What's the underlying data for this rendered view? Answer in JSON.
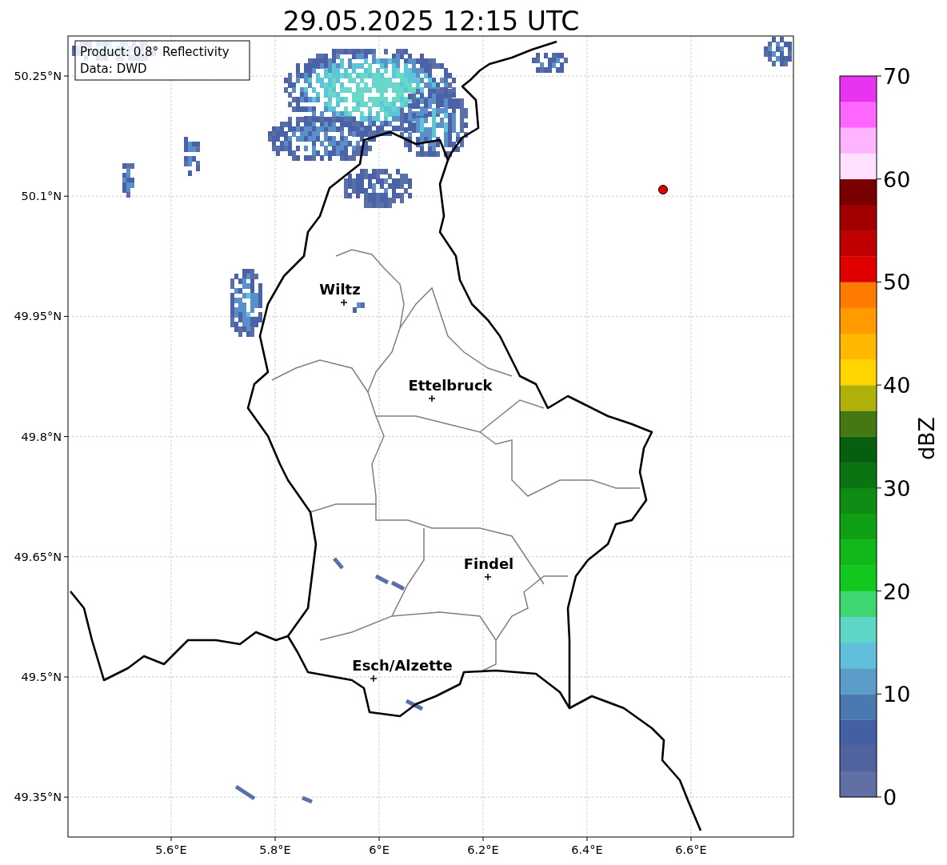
{
  "title": "29.05.2025 12:15 UTC",
  "info_box": [
    "Product: 0.8° Reflectivity",
    "Data: DWD"
  ],
  "lat_ticks": [
    "50.25°N",
    "50.1°N",
    "49.95°N",
    "49.8°N",
    "49.65°N",
    "49.5°N",
    "49.35°N"
  ],
  "lon_ticks": [
    "5.6°E",
    "5.8°E",
    "6°E",
    "6.2°E",
    "6.4°E",
    "6.6°E"
  ],
  "cities": [
    {
      "name": "Wiltz"
    },
    {
      "name": "Ettelbruck"
    },
    {
      "name": "Findel"
    },
    {
      "name": "Esch/Alzette"
    }
  ],
  "colorbar": {
    "label": "dBZ",
    "ticks": [
      "70",
      "60",
      "50",
      "40",
      "30",
      "20",
      "10",
      "0"
    ],
    "segments": [
      {
        "color": "#6070a4"
      },
      {
        "color": "#50639e"
      },
      {
        "color": "#4360a5"
      },
      {
        "color": "#4a78b0"
      },
      {
        "color": "#5a9dc8"
      },
      {
        "color": "#62bfdc"
      },
      {
        "color": "#5ed6c6"
      },
      {
        "color": "#3ed670"
      },
      {
        "color": "#10c81e"
      },
      {
        "color": "#10b81a"
      },
      {
        "color": "#10a016"
      },
      {
        "color": "#0e8c14"
      },
      {
        "color": "#0b7412"
      },
      {
        "color": "#075e0e"
      },
      {
        "color": "#447810"
      },
      {
        "color": "#b0b00a"
      },
      {
        "color": "#ffd500"
      },
      {
        "color": "#ffb800"
      },
      {
        "color": "#ff9a00"
      },
      {
        "color": "#ff7a00"
      },
      {
        "color": "#e00000"
      },
      {
        "color": "#c00000"
      },
      {
        "color": "#a00000"
      },
      {
        "color": "#780000"
      },
      {
        "color": "#ffe0ff"
      },
      {
        "color": "#ffb4ff"
      },
      {
        "color": "#ff66ff"
      },
      {
        "color": "#e834f0"
      }
    ]
  }
}
